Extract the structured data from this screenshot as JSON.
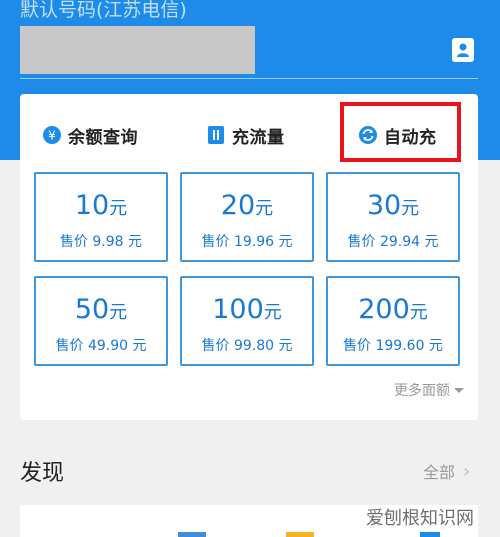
{
  "header": {
    "hint": "默认号码(江苏电信)",
    "background_color": "#1f8be8"
  },
  "tabs": [
    {
      "label": "余额查询",
      "icon": "balance-yen-icon"
    },
    {
      "label": "充流量",
      "icon": "data-flow-icon"
    },
    {
      "label": "自动充",
      "icon": "auto-refresh-icon"
    }
  ],
  "options": [
    {
      "amount": "10",
      "unit": "元",
      "price": "售价 9.98 元"
    },
    {
      "amount": "20",
      "unit": "元",
      "price": "售价 19.96 元"
    },
    {
      "amount": "30",
      "unit": "元",
      "price": "售价 29.94 元"
    },
    {
      "amount": "50",
      "unit": "元",
      "price": "售价 49.90 元"
    },
    {
      "amount": "100",
      "unit": "元",
      "price": "售价 99.80 元"
    },
    {
      "amount": "200",
      "unit": "元",
      "price": "售价 199.60 元"
    }
  ],
  "more_label": "更多面额",
  "section": {
    "title": "发现",
    "all_label": "全部"
  },
  "watermark": "爱刨根知识网",
  "colors": {
    "accent": "#1878d6",
    "highlight": "#e8141c"
  }
}
